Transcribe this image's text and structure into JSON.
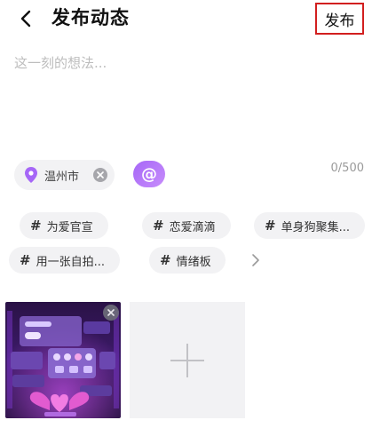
{
  "header": {
    "title": "发布动态",
    "publish_label": "发布",
    "back_icon": "chevron-left-icon"
  },
  "composer": {
    "placeholder": "这一刻的想法...",
    "value": "",
    "counter": "0/500"
  },
  "location": {
    "label": "温州市",
    "icon": "location-pin-icon",
    "close_icon": "close-circle-icon",
    "accent": "#a667f7"
  },
  "mention": {
    "icon": "at-icon",
    "glyph": "@"
  },
  "topics": {
    "items": [
      {
        "label": "为爱官宣"
      },
      {
        "label": "恋爱滴滴"
      },
      {
        "label": "单身狗聚集..."
      },
      {
        "label": "用一张自拍..."
      },
      {
        "label": "情绪板"
      }
    ],
    "hash": "#",
    "more_icon": "chevron-right-icon"
  },
  "media": {
    "thumbnail_icon": "photo-thumbnail",
    "remove_icon": "close-circle-icon",
    "add_icon": "plus-icon"
  }
}
